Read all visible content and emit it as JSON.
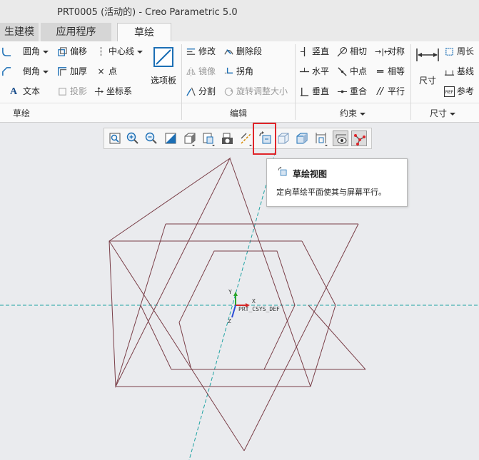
{
  "window": {
    "title": "PRT0005 (活动的) - Creo Parametric 5.0"
  },
  "tabs": [
    {
      "label": "生建模",
      "active": false
    },
    {
      "label": "应用程序",
      "active": false
    },
    {
      "label": "草绘",
      "active": true
    }
  ],
  "ribbon": {
    "sketch": {
      "label": "草绘",
      "fillet": "圆角",
      "offset": "偏移",
      "centerline": "中心线",
      "chamfer": "倒角",
      "thicken": "加厚",
      "point": "点",
      "text": "文本",
      "project": "投影",
      "csys": "坐标系",
      "palette": "选项板"
    },
    "edit": {
      "label": "编辑",
      "modify": "修改",
      "delete_segment": "删除段",
      "mirror": "镜像",
      "corner": "拐角",
      "divide": "分割",
      "rotate_resize": "旋转调整大小"
    },
    "constrain": {
      "label": "约束",
      "vertical": "竖直",
      "tangent": "相切",
      "symmetric": "对称",
      "horizontal": "水平",
      "midpoint": "中点",
      "equal": "相等",
      "perpendicular": "垂直",
      "coincident": "重合",
      "parallel": "平行"
    },
    "dimension": {
      "label": "尺寸",
      "dimension": "尺寸",
      "perimeter": "周长",
      "baseline": "基线",
      "reference": "参考"
    }
  },
  "tooltip": {
    "title": "草绘视图",
    "description": "定向草绘平面使其与屏幕平行。"
  },
  "canvas": {
    "csys_label": "PRT_CSYS_DEF",
    "x_axis": "X",
    "y_axis": "Y",
    "z_axis": "Z"
  },
  "colors": {
    "highlight": "#e0252a",
    "sketch_line": "#7a3f48",
    "axis_line": "#1fa3a3",
    "ribbon_bg": "#fafafa",
    "canvas_bg": "#eaebee"
  }
}
